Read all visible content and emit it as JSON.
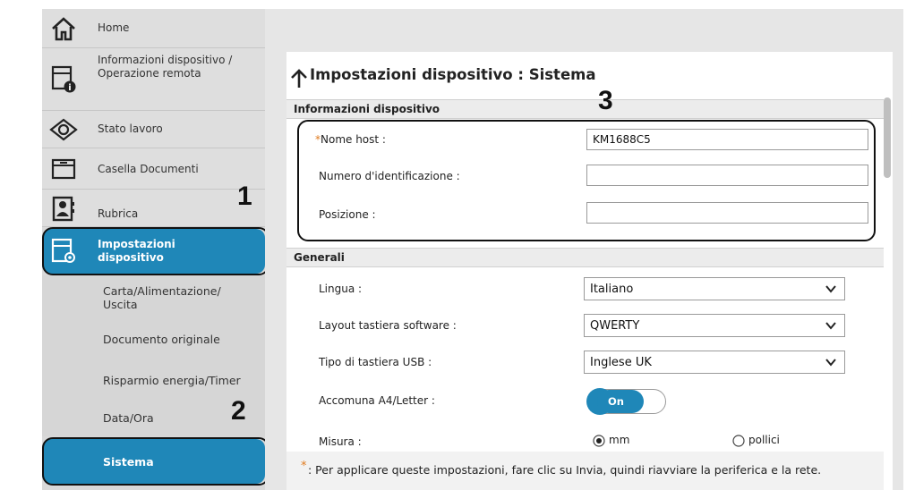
{
  "sidebar": {
    "items": [
      {
        "label": "Home",
        "icon": "home-icon"
      },
      {
        "label": "Informazioni dispositivo / Operazione remota",
        "icon": "device-info-icon"
      },
      {
        "label": "Stato lavoro",
        "icon": "eye-icon"
      },
      {
        "label": "Casella Documenti",
        "icon": "folder-icon"
      },
      {
        "label": "Rubrica",
        "icon": "address-book-icon"
      },
      {
        "label": "Impostazioni dispositivo",
        "icon": "device-settings-icon"
      }
    ],
    "subitems": [
      {
        "label": "Carta/Alimentazione/ Uscita"
      },
      {
        "label": "Documento originale"
      },
      {
        "label": "Risparmio energia/Timer"
      },
      {
        "label": "Data/Ora"
      },
      {
        "label": "Sistema"
      }
    ]
  },
  "callouts": {
    "one": "1",
    "two": "2",
    "three": "3"
  },
  "page": {
    "title": "Impostazioni dispositivo : Sistema"
  },
  "sections": {
    "device_info": "Informazioni dispositivo",
    "general": "Generali"
  },
  "device_info": {
    "host_label": "Nome host :",
    "host_value": "KM1688C5",
    "id_label": "Numero d'identificazione :",
    "id_value": "",
    "position_label": "Posizione :",
    "position_value": ""
  },
  "general": {
    "language_label": "Lingua :",
    "language_value": "Italiano",
    "keyboard_label": "Layout tastiera software :",
    "keyboard_value": "QWERTY",
    "usb_label": "Tipo di tastiera USB :",
    "usb_value": "Inglese UK",
    "a4_label": "Accomuna A4/Letter :",
    "a4_value": "On",
    "measure_label": "Misura :",
    "measure_mm": "mm",
    "measure_inch": "pollici",
    "measure_selected": "mm"
  },
  "footnote": {
    "star": "*",
    "text": ": Per applicare queste impostazioni, fare clic su Invia, quindi riavviare la periferica e la rete."
  },
  "colors": {
    "accent": "#1f87b8",
    "sidebar": "#d9d9d9",
    "toggle": "#1f87b8",
    "required": "#e07a1e"
  }
}
